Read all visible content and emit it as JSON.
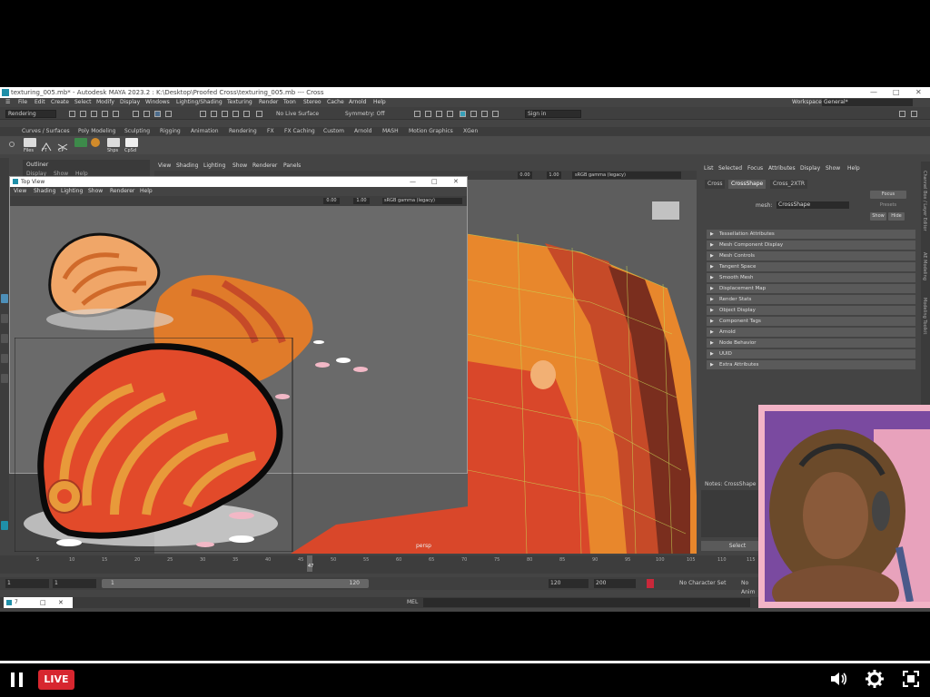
{
  "window": {
    "title": "texturing_005.mb* - Autodesk MAYA 2023.2 : K:\\Desktop\\Proofed Cross\\texturing_005.mb --- Cross",
    "workspace_label": "Workspace:",
    "workspace_value": "General*"
  },
  "menu": [
    "File",
    "Edit",
    "Create",
    "Select",
    "Modify",
    "Display",
    "Windows",
    "Lighting/Shading",
    "Texturing",
    "Render",
    "Toon",
    "Stereo",
    "Cache",
    "Arnold",
    "Help"
  ],
  "status": {
    "mode": "Rendering",
    "live_surface": "No Live Surface",
    "symmetry": "Symmetry: Off",
    "sign_in": "Sign in"
  },
  "shelf_tabs": [
    "Curves / Surfaces",
    "Poly Modeling",
    "Sculpting",
    "Rigging",
    "Animation",
    "Rendering",
    "FX",
    "FX Caching",
    "Custom",
    "Arnold",
    "MASH",
    "Motion Graphics",
    "XGen"
  ],
  "shelf_labels": [
    "Files",
    "FT",
    "CP",
    "",
    "",
    "Shps",
    "CpSd"
  ],
  "outliner": {
    "title": "Outliner",
    "menu": [
      "Display",
      "Show",
      "Help"
    ]
  },
  "persp": {
    "menu": [
      "View",
      "Shading",
      "Lighting",
      "Show",
      "Renderer",
      "Panels"
    ],
    "value_a": "0.00",
    "value_b": "1.00",
    "colorspace": "sRGB gamma (legacy)",
    "label": "persp"
  },
  "topview": {
    "title": "Top View",
    "menu": [
      "View",
      "Shading",
      "Lighting",
      "Show",
      "Renderer",
      "Help"
    ],
    "value_a": "0.00",
    "value_b": "1.00",
    "colorspace": "sRGB gamma (legacy)"
  },
  "attr": {
    "menu": [
      "List",
      "Selected",
      "Focus",
      "Attributes",
      "Display",
      "Show",
      "Help"
    ],
    "tabs": [
      "Cross",
      "CrossShape",
      "Cross_2XTR"
    ],
    "mesh_label": "mesh:",
    "mesh_value": "CrossShape",
    "focus": "Focus",
    "presets": "Presets",
    "show": "Show",
    "hide": "Hide",
    "sections": [
      "Tessellation Attributes",
      "Mesh Component Display",
      "Mesh Controls",
      "Tangent Space",
      "Smooth Mesh",
      "Displacement Map",
      "Render Stats",
      "Object Display",
      "Component Tags",
      "Arnold",
      "Node Behavior",
      "UUID",
      "Extra Attributes"
    ],
    "notes": "Notes: CrossShape",
    "select": "Select"
  },
  "side_tabs": [
    "Channel Box / Layer Editor",
    "AE Modeling",
    "Modeling Toolkit"
  ],
  "timeline": {
    "ticks": [
      "5",
      "10",
      "15",
      "20",
      "25",
      "30",
      "35",
      "40",
      "45",
      "50",
      "55",
      "60",
      "65",
      "70",
      "75",
      "80",
      "85",
      "90",
      "95",
      "100",
      "105",
      "110",
      "115"
    ],
    "current": "47",
    "start": "1",
    "start2": "1",
    "range_start": "1",
    "range_end": "120",
    "end": "120",
    "end2": "200",
    "character": "No Character Set",
    "anim_layer": "No Anim"
  },
  "cmd": {
    "mel": "MEL",
    "task": "7"
  },
  "player": {
    "live": "LIVE"
  },
  "colors": {
    "accent": "#d7262f",
    "maya_bg": "#444444",
    "orange": "#e58a2a",
    "red": "#d9472a"
  }
}
